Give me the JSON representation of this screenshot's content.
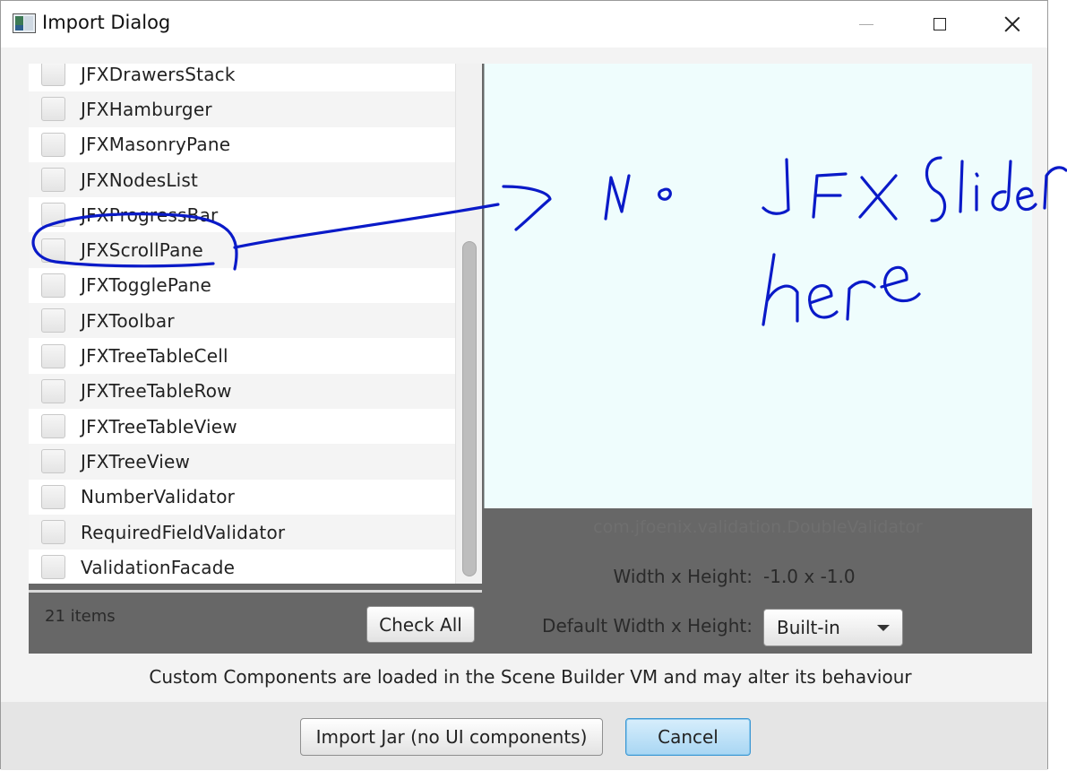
{
  "window": {
    "title": "Import Dialog",
    "controls": [
      "minimize",
      "maximize",
      "close"
    ]
  },
  "component_list": {
    "items": [
      {
        "label": "JFXDrawersStack",
        "checked": false
      },
      {
        "label": "JFXHamburger",
        "checked": false
      },
      {
        "label": "JFXMasonryPane",
        "checked": false
      },
      {
        "label": "JFXNodesList",
        "checked": false
      },
      {
        "label": "JFXProgressBar",
        "checked": false
      },
      {
        "label": "JFXScrollPane",
        "checked": false
      },
      {
        "label": "JFXTogglePane",
        "checked": false
      },
      {
        "label": "JFXToolbar",
        "checked": false
      },
      {
        "label": "JFXTreeTableCell",
        "checked": false
      },
      {
        "label": "JFXTreeTableRow",
        "checked": false
      },
      {
        "label": "JFXTreeTableView",
        "checked": false
      },
      {
        "label": "JFXTreeView",
        "checked": false
      },
      {
        "label": "NumberValidator",
        "checked": false
      },
      {
        "label": "RequiredFieldValidator",
        "checked": false
      },
      {
        "label": "ValidationFacade",
        "checked": false
      }
    ],
    "count_label": "21 items",
    "check_all_label": "Check All"
  },
  "preview": {
    "class_name": "com.jfoenix.validation.DoubleValidator",
    "width_height_label": "Width x Height:",
    "width_height_value": "-1.0 x -1.0",
    "default_wh_label": "Default Width x Height:",
    "default_wh_selected": "Built-in"
  },
  "annotation": {
    "handwritten_text": "No JFXSlider here",
    "color": "#0a1ac8"
  },
  "footer": {
    "warning": "Custom Components are loaded in the Scene Builder VM and may alter its behaviour",
    "import_jar_label": "Import Jar (no UI components)",
    "cancel_label": "Cancel"
  }
}
